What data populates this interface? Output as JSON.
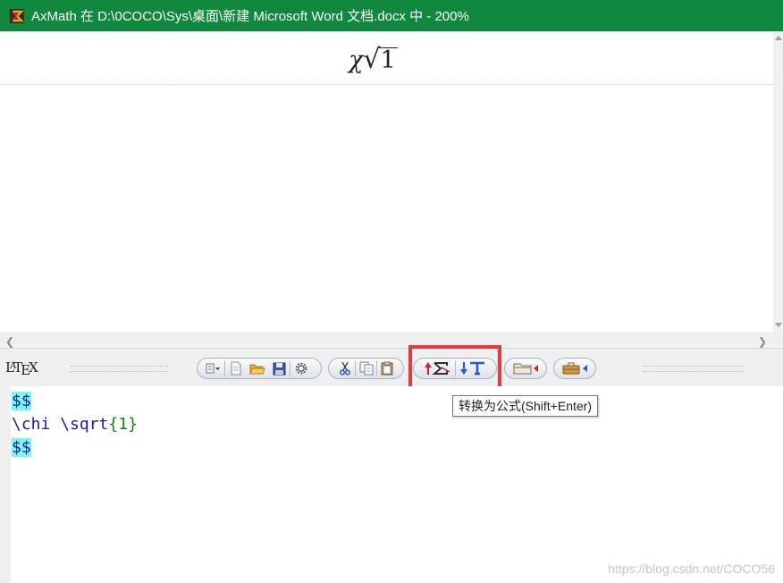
{
  "window": {
    "title": "AxMath 在 D:\\0COCO\\Sys\\桌面\\新建 Microsoft Word 文档.docx 中 - 200%"
  },
  "preview": {
    "formula_chi": "χ",
    "formula_radical": "√",
    "formula_radicand": "1"
  },
  "toolbar": {
    "logo_text": "LATEX",
    "buttons": [
      {
        "name": "menu-dropdown-button",
        "icon": "menu-icon"
      },
      {
        "name": "new-button",
        "icon": "new-document-icon"
      },
      {
        "name": "open-button",
        "icon": "folder-open-icon"
      },
      {
        "name": "save-button",
        "icon": "save-icon"
      },
      {
        "name": "settings-button",
        "icon": "gear-icon"
      },
      {
        "name": "cut-button",
        "icon": "scissors-icon"
      },
      {
        "name": "copy-button",
        "icon": "copy-icon"
      },
      {
        "name": "paste-button",
        "icon": "paste-icon"
      },
      {
        "name": "convert-to-formula-button",
        "icon": "arrow-up-sigma-icon"
      },
      {
        "name": "convert-to-text-button",
        "icon": "arrow-down-t-icon"
      },
      {
        "name": "insert-menu-button",
        "icon": "folder-triangle-icon"
      },
      {
        "name": "toolbox-menu-button",
        "icon": "toolbox-triangle-icon"
      }
    ],
    "tooltip": "转换为公式(Shift+Enter)"
  },
  "editor": {
    "line1": "$$",
    "line2_cmd": "\\chi \\sqrt",
    "line2_open": "{",
    "line2_arg": "1",
    "line2_close": "}",
    "line3": "$$"
  },
  "watermark": "https://blog.csdn.net/COCO56",
  "colors": {
    "titlebar": "#10893e",
    "highlight": "#e6393b",
    "code_text": "#1a1aa6",
    "code_number": "#0a8a0a",
    "delimiter_highlight": "#7cf5f5"
  }
}
